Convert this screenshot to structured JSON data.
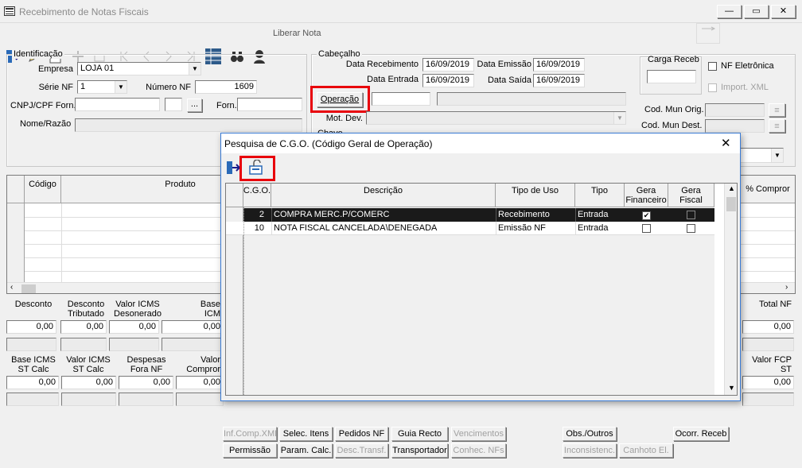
{
  "window": {
    "title": "Recebimento de Notas Fiscais",
    "min_glyph": "—",
    "max_glyph": "▭",
    "close_glyph": "✕"
  },
  "toolbar": {
    "liberar_nota": "Liberar Nota"
  },
  "identificacao": {
    "title": "Identificação",
    "empresa_label": "Empresa",
    "empresa_value": "LOJA 01",
    "serie_label": "Série NF",
    "serie_value": "1",
    "numero_label": "Número NF",
    "numero_value": "1609",
    "cnpj_label": "CNPJ/CPF Forn.",
    "cnpj_value": "",
    "browse_label": "...",
    "forn_label": "Forn.",
    "forn_value": "",
    "nome_label": "Nome/Razão",
    "nome_value": ""
  },
  "cabecalho": {
    "title": "Cabeçalho",
    "data_receb_label": "Data Recebimento",
    "data_receb_value": "16/09/2019",
    "data_emissao_label": "Data Emissão",
    "data_emissao_value": "16/09/2019",
    "data_entrada_label": "Data Entrada",
    "data_entrada_value": "16/09/2019",
    "data_saida_label": "Data Saída",
    "data_saida_value": "16/09/2019",
    "operacao_button": "Operação",
    "mot_dev_label": "Mot. Dev.",
    "chave_label": "Chave",
    "carga_receb_label": "Carga Receb",
    "nf_eletronica_label": "NF Eletrônica",
    "import_xml_label": "Import. XML",
    "cod_mun_orig_label": "Cod. Mun Orig.",
    "cod_mun_dest_label": "Cod. Mun Dest."
  },
  "products": {
    "headers": [
      "Código",
      "Produto",
      "% Compror"
    ]
  },
  "totals1": {
    "labels": [
      "Desconto",
      "Desconto Tributado",
      "Valor ICMS Desonerado",
      "Base ICM"
    ],
    "values": [
      "0,00",
      "0,00",
      "0,00",
      "0,00"
    ],
    "total_label": "Total NF",
    "total_value": "0,00"
  },
  "totals2": {
    "labels": [
      "Base ICMS ST Calc",
      "Valor ICMS ST Calc",
      "Despesas Fora NF",
      "Valor Compror"
    ],
    "values": [
      "0,00",
      "0,00",
      "0,00",
      "0,00"
    ],
    "fcp_label": "Valor FCP ST",
    "fcp_value": "0,00"
  },
  "bottom_buttons": {
    "inf_comp_xml": "Inf.Comp.XML",
    "selec_itens": "Selec. Itens",
    "pedidos_nf": "Pedidos NF",
    "guia_recto": "Guia Recto",
    "vencimentos": "Vencimentos",
    "obs_outros": "Obs./Outros",
    "ocorr_receb": "Ocorr. Receb",
    "permissao": "Permissão",
    "param_calc": "Param. Calc.",
    "desc_transf": "Desc.Transf.",
    "transportador": "Transportador",
    "conhec_nfs": "Conhec. NFs",
    "inconsistenc": "Inconsistenc.",
    "canhoto_el": "Canhoto El."
  },
  "dialog": {
    "title": "Pesquisa de C.G.O. (Código Geral de Operação)",
    "close_glyph": "✕",
    "columns": [
      "C.G.O.",
      "Descrição",
      "Tipo de Uso",
      "Tipo",
      "Gera Financeiro",
      "Gera Fiscal"
    ],
    "rows": [
      {
        "cgo": "2",
        "descricao": "COMPRA MERC.P/COMERC",
        "tipo_uso": "Recebimento",
        "tipo": "Entrada",
        "gera_financeiro": true,
        "gera_fiscal": false,
        "selected": true
      },
      {
        "cgo": "10",
        "descricao": "NOTA FISCAL CANCELADA\\DENEGADA",
        "tipo_uso": "Emissão NF",
        "tipo": "Entrada",
        "gera_financeiro": false,
        "gera_fiscal": false,
        "selected": false
      }
    ]
  },
  "colors": {
    "selected_row": "#1a1a1a",
    "highlight": "#e8000b",
    "dialog_border": "#3a7bd5"
  }
}
